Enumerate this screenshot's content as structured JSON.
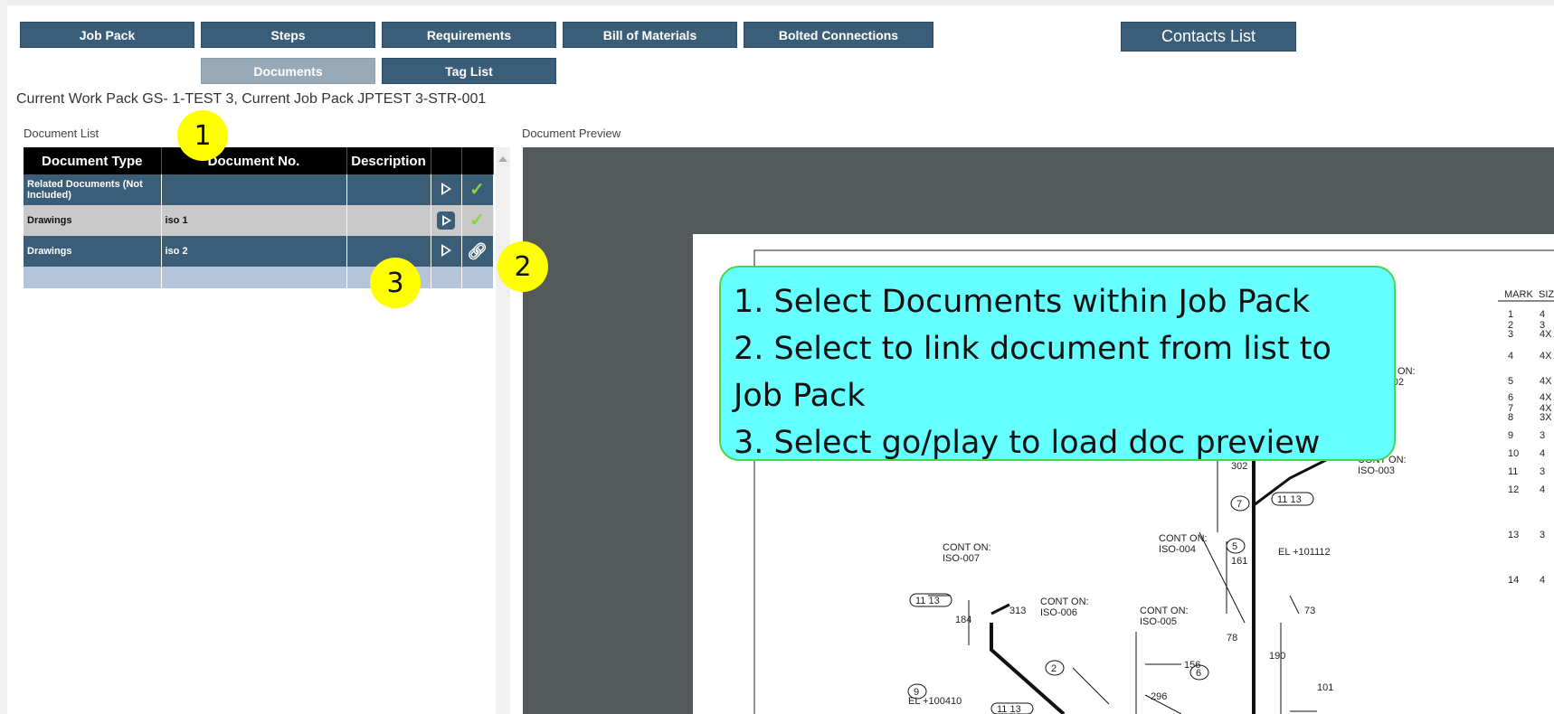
{
  "nav": {
    "job_pack": "Job Pack",
    "steps": "Steps",
    "requirements": "Requirements",
    "bill_of_materials": "Bill of Materials",
    "bolted_connections": "Bolted Connections",
    "contacts_list": "Contacts List",
    "documents": "Documents",
    "tag_list": "Tag List"
  },
  "context_line": "Current Work Pack GS-         1-TEST 3, Current Job Pack JPTEST 3-STR-001",
  "labels": {
    "document_list": "Document List",
    "document_preview": "Document Preview"
  },
  "table": {
    "headers": [
      "Document Type",
      "Document No.",
      "Description"
    ],
    "rows": [
      {
        "type": "Related Documents (Not Included)",
        "number": "",
        "description": "",
        "status": "check"
      },
      {
        "type": "Drawings",
        "number": "iso 1",
        "description": "",
        "status": "check"
      },
      {
        "type": "Drawings",
        "number": "iso 2",
        "description": "",
        "status": "link"
      }
    ]
  },
  "markers": {
    "m1": "1",
    "m2": "2",
    "m3": "3"
  },
  "callout": {
    "line1": "1. Select Documents within Job Pack",
    "line2": "2. Select to link document from list to",
    "line3": "Job Pack",
    "line4": "3. Select go/play to load doc preview"
  },
  "drawing": {
    "cont_002": "CONT ON:",
    "iso_002": "ISO-002",
    "cont_003": "CONT ON:",
    "iso_003": "ISO-003",
    "cont_004": "CONT ON:",
    "iso_004": "ISO-004",
    "cont_005": "CONT ON:",
    "iso_005": "ISO-005",
    "cont_006": "CONT ON:",
    "iso_006": "ISO-006",
    "cont_007": "CONT ON:",
    "iso_007": "ISO-007",
    "el_101112": "EL +101112",
    "el_100410": "EL +100410",
    "dim_302": "302",
    "dim_161": "161",
    "dim_156": "156",
    "dim_313": "313",
    "dim_184": "184",
    "dim_296": "296",
    "dim_190": "190",
    "dim_101": "101",
    "dim_73": "73",
    "dim_78": "78",
    "tag_11_13": "11  13",
    "mark_header": "MARK",
    "size_header": "SIZ",
    "marks": [
      "1",
      "2",
      "3",
      "4",
      "5",
      "6",
      "7",
      "8",
      "9",
      "10",
      "11",
      "12",
      "13",
      "14"
    ],
    "sizes": [
      "4",
      "3",
      "4X",
      "4X",
      "4X",
      "4X",
      "4X",
      "3X",
      "3",
      "4",
      "3",
      "4",
      "3",
      "4"
    ],
    "circle_labels": [
      "7",
      "5",
      "2",
      "6",
      "9"
    ]
  },
  "colors": {
    "nav_bg": "#3b5e78",
    "nav_active": "#98aab8",
    "callout_bg": "#66ffff",
    "callout_border": "#4fd34f",
    "marker_bg": "#ffff00",
    "check": "#8ed23a",
    "preview_bg": "#54595c"
  }
}
